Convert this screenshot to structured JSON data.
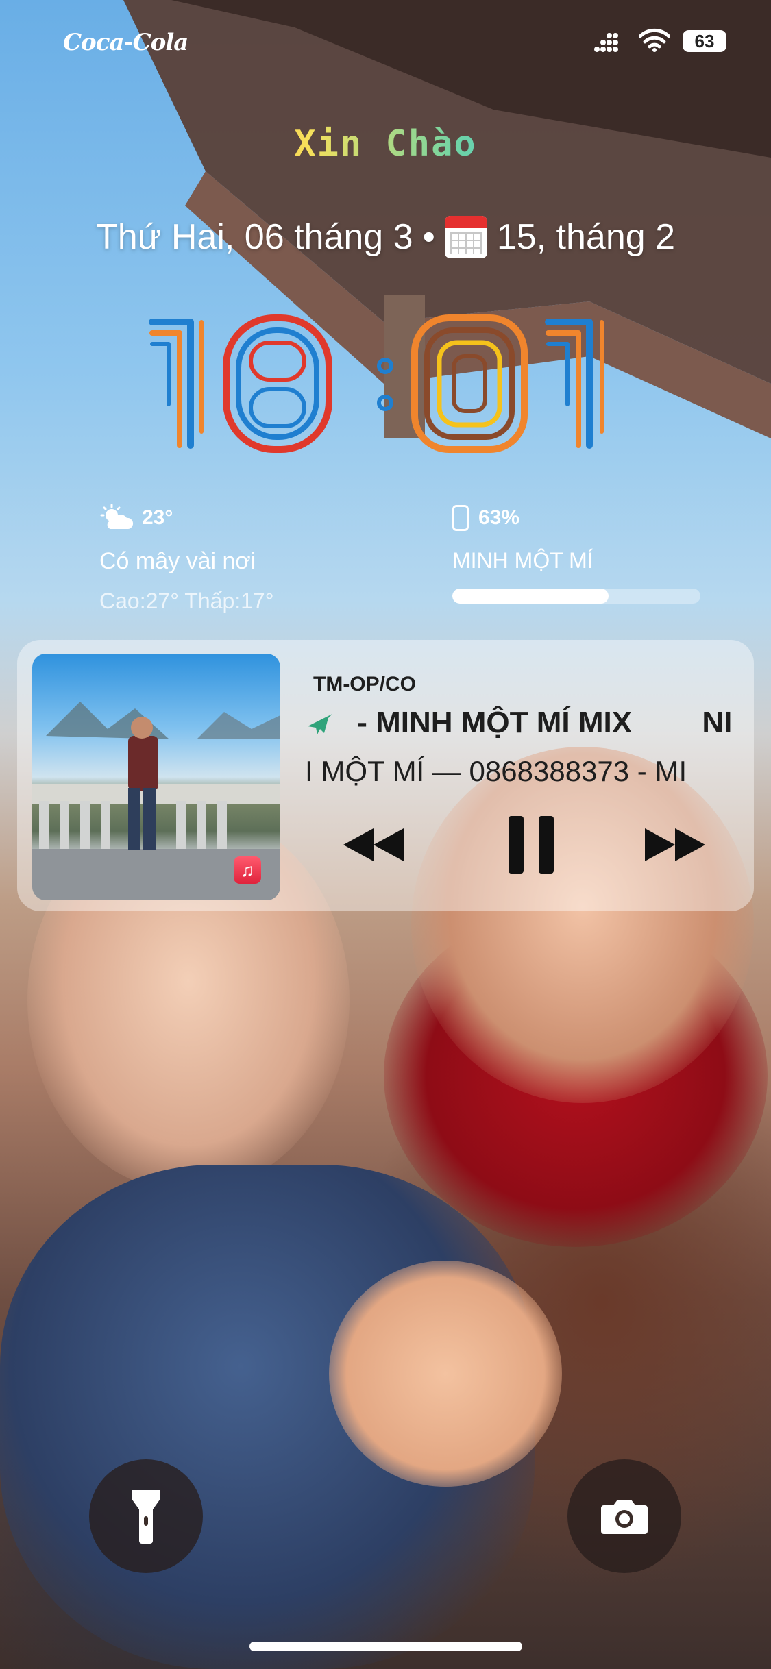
{
  "status_bar": {
    "carrier": "Coca-Cola",
    "battery_level": "63",
    "icons": [
      "signal-icon",
      "wifi-icon",
      "battery-icon"
    ]
  },
  "lock_screen": {
    "greeting": "Xin Chào",
    "date": "Thứ Hai, 06 tháng 3",
    "separator": "•",
    "lunar_date": "15, tháng 2",
    "time_hours": "18",
    "time_minutes": "01"
  },
  "weather": {
    "icon": "partly-cloudy-icon",
    "temperature": "23°",
    "description": "Có mây vài nơi",
    "range": "Cao:27° Thấp:17°"
  },
  "battery_widget": {
    "percent_label": "63%",
    "device_name": "MINH MỘT MÍ",
    "level": 0.63
  },
  "music_player": {
    "label": "TM-OP/CO",
    "title": "- MINH MỘT MÍ MIX",
    "title_trail": "NI",
    "artist": "MỘT MÍ — 0868388373 - MI",
    "artist_lead": "I",
    "controls": [
      "previous-icon",
      "pause-icon",
      "next-icon"
    ]
  },
  "bottom": {
    "left_button": "flashlight-icon",
    "right_button": "camera-icon"
  },
  "colors": {
    "digit_orange": "#f0852d",
    "digit_blue": "#1f7fd0",
    "digit_red": "#e0392c",
    "digit_yellow": "#f5c21b",
    "digit_brown": "#8a4a2b"
  }
}
